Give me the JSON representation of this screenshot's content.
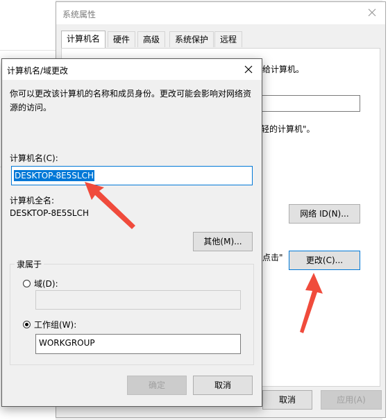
{
  "sysprops": {
    "title": "系统属性",
    "tabs": [
      "计算机名",
      "硬件",
      "高级",
      "系统保护",
      "远程"
    ],
    "partial_text_1": "给计算机。",
    "partial_text_2": "轻的计算机\"。",
    "partial_text_3": "点击\"",
    "network_id_button": "网络 ID(N)...",
    "change_button": "更改(C)...",
    "cancel_button": "取消",
    "apply_button": "应用(A)"
  },
  "dialog": {
    "title": "计算机名/域更改",
    "description": "你可以更改该计算机的名称和成员身份。更改可能会影响对网络资源的访问。",
    "computer_name_label": "计算机名(C):",
    "computer_name_value": "DESKTOP-8E5SLCH",
    "full_name_label": "计算机全名:",
    "full_name_value": "DESKTOP-8E5SLCH",
    "more_button": "其他(M)...",
    "member_of_label": "隶属于",
    "domain_label": "域(D):",
    "domain_value": "",
    "workgroup_label": "工作组(W):",
    "workgroup_value": "WORKGROUP",
    "ok_button": "确定",
    "cancel_button": "取消"
  },
  "colors": {
    "accent": "#0078d7",
    "arrow": "#f04b3c"
  }
}
